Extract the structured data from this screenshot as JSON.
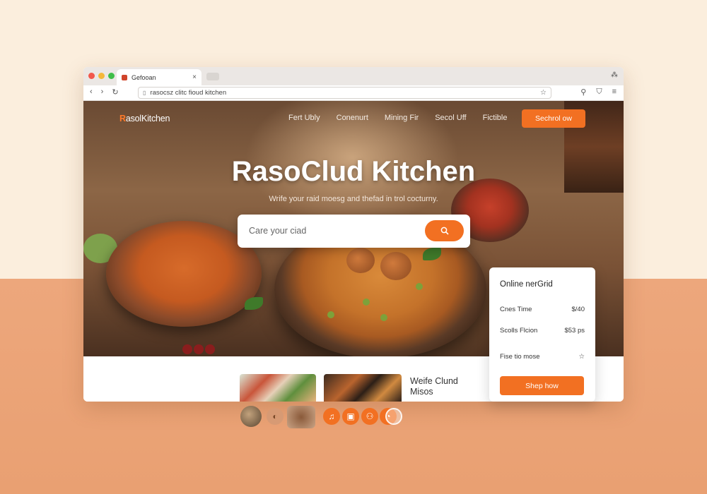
{
  "browser": {
    "tab_title": "Gefooan",
    "tab_close": "×",
    "url": "rasocsz clitc fioud kitchen",
    "back_icon": "‹",
    "forward_icon": "›",
    "reload_icon": "↻",
    "menu_icon": "≡"
  },
  "site": {
    "logo_initial": "R",
    "logo_rest": "asolKitchen",
    "nav": [
      "Fert Ubly",
      "Conenurt",
      "Mining Fir",
      "Secol Uff",
      "Fictible"
    ],
    "nav_button": "Sechrol ow",
    "hero_title": "RasoClud Kitchen",
    "hero_subtitle": "Wrife your raid moesg and thefad in trol cocturny.",
    "search_placeholder": "Care your ciad",
    "promo_line1": "Weife Clund",
    "promo_line2": "Misos"
  },
  "card": {
    "title": "Online nerGrid",
    "rows": [
      {
        "label": "Cnes Time",
        "value": "$/40"
      },
      {
        "label": "Scolls Flcion",
        "value": "$53 ps"
      },
      {
        "label": "Fise tio mose",
        "value": "☆"
      }
    ],
    "button": "Shep how"
  },
  "colors": {
    "accent": "#f27022",
    "bg_top": "#fbeedd",
    "bg_bottom": "#eda77c"
  },
  "icons": {
    "search": "search-icon",
    "lock": "lock-icon"
  }
}
